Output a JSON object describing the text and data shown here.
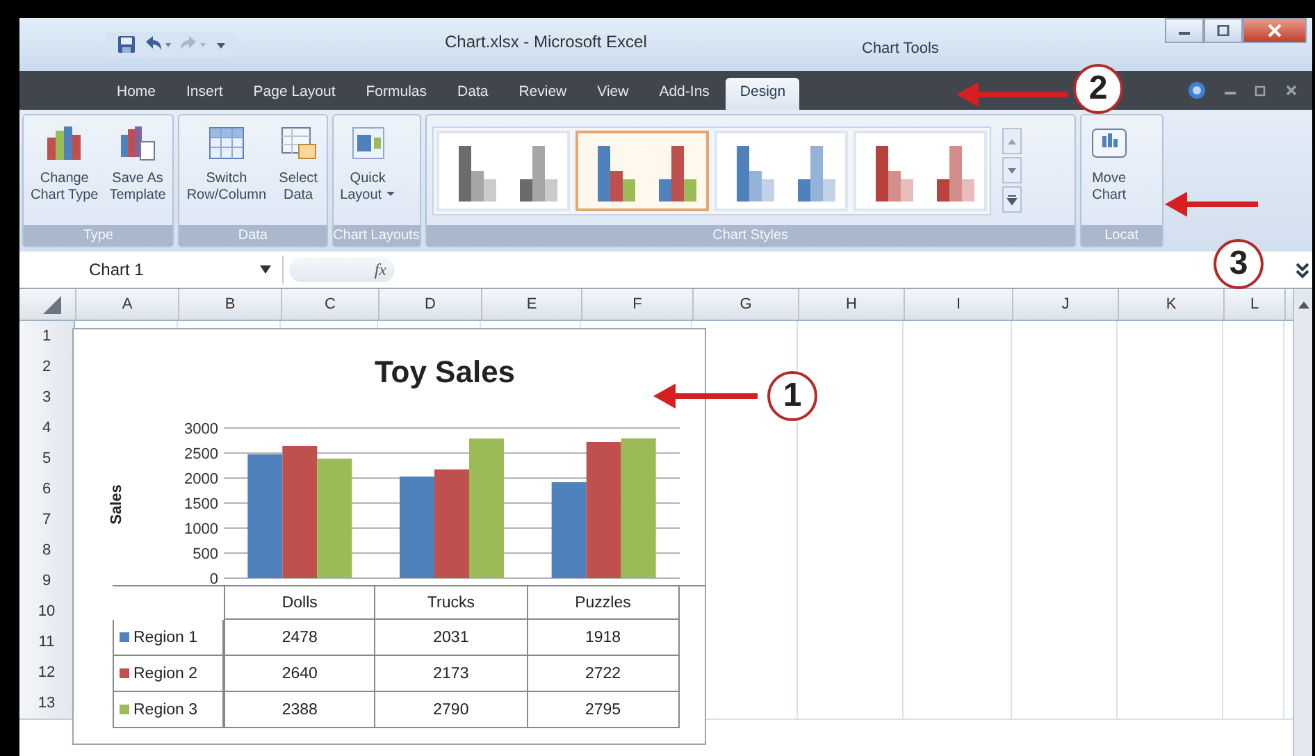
{
  "window": {
    "title": "Chart.xlsx - Microsoft Excel",
    "context_label": "Chart Tools"
  },
  "tabs": [
    {
      "label": "Home",
      "selected": false
    },
    {
      "label": "Insert",
      "selected": false
    },
    {
      "label": "Page Layout",
      "selected": false
    },
    {
      "label": "Formulas",
      "selected": false
    },
    {
      "label": "Data",
      "selected": false
    },
    {
      "label": "Review",
      "selected": false
    },
    {
      "label": "View",
      "selected": false
    },
    {
      "label": "Add-Ins",
      "selected": false
    },
    {
      "label": "Design",
      "selected": true
    }
  ],
  "ribbon": {
    "groups": [
      {
        "title": "Type",
        "buttons": [
          {
            "kind": "change-type",
            "label": "Change\nChart Type"
          },
          {
            "kind": "template",
            "label": "Save As\nTemplate"
          }
        ]
      },
      {
        "title": "Data",
        "buttons": [
          {
            "kind": "switch",
            "label": "Switch\nRow/Column"
          },
          {
            "kind": "select",
            "label": "Select\nData"
          }
        ]
      },
      {
        "title": "Chart Layouts",
        "buttons": [
          {
            "kind": "layout",
            "label": "Quick\nLayout",
            "dropdown": true
          }
        ]
      }
    ],
    "chart_styles": {
      "title": "Chart Styles",
      "items": [
        {
          "kind": "mono",
          "color": "#6b6b6b",
          "selected": false
        },
        {
          "kind": "varied",
          "color": "#4f81bd",
          "selected": true
        },
        {
          "kind": "mono",
          "color": "#4f81bd",
          "selected": false
        },
        {
          "kind": "mono",
          "color": "#b8423c",
          "selected": false
        }
      ]
    },
    "location": {
      "title": "Locat",
      "buttons": [
        {
          "kind": "move",
          "label": "Move\nChart"
        }
      ]
    }
  },
  "formula_bar": {
    "name_box": "Chart 1",
    "fx": "fx"
  },
  "sheet": {
    "columns": [
      "A",
      "B",
      "C",
      "D",
      "E",
      "F",
      "G",
      "H",
      "I",
      "J",
      "K",
      "L"
    ],
    "rows": [
      "1",
      "2",
      "3",
      "4",
      "5",
      "6",
      "7",
      "8",
      "9",
      "10",
      "11",
      "12",
      "13"
    ]
  },
  "chart": {
    "chart_data": {
      "type": "bar",
      "title": "Toy Sales",
      "ylabel": "Sales",
      "categories": [
        "Dolls",
        "Trucks",
        "Puzzles"
      ],
      "ylim": [
        0,
        3000
      ],
      "yticks": [
        0,
        500,
        1000,
        1500,
        2000,
        2500,
        3000
      ],
      "series": [
        {
          "name": "Region 1",
          "color": "#4f81bd",
          "values": [
            2478,
            2031,
            1918
          ]
        },
        {
          "name": "Region 2",
          "color": "#c0504d",
          "values": [
            2640,
            2173,
            2722
          ]
        },
        {
          "name": "Region 3",
          "color": "#9bbb59",
          "values": [
            2388,
            2790,
            2795
          ]
        }
      ],
      "grid": true,
      "legend": "bottom-left"
    },
    "data_table": {
      "rows": [
        {
          "values": [
            "2478",
            "2031",
            "1918"
          ]
        },
        {
          "values": [
            "2640",
            "2173",
            "2722"
          ]
        },
        {
          "values": [
            "2388",
            "2790",
            "2795"
          ]
        }
      ]
    }
  },
  "annotations": [
    {
      "label": "1"
    },
    {
      "label": "2"
    },
    {
      "label": "3"
    }
  ]
}
